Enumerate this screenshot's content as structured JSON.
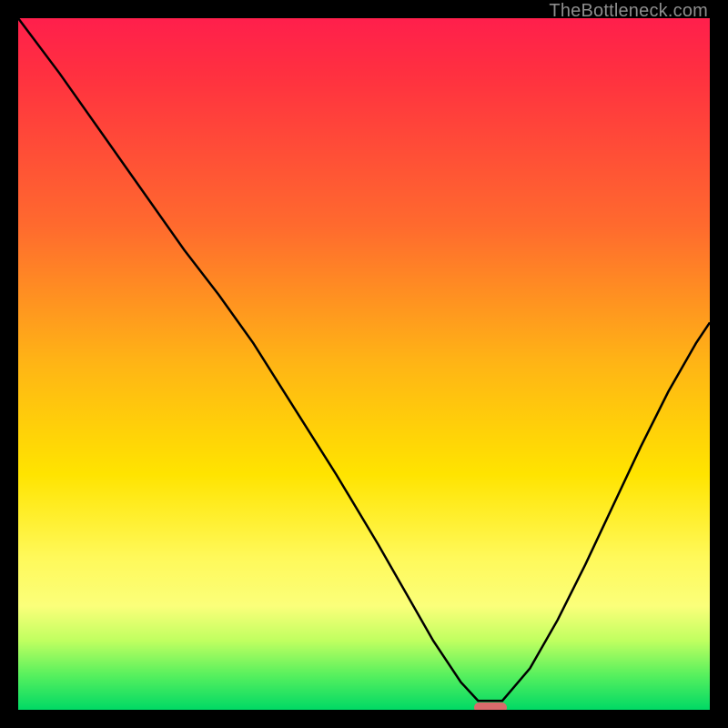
{
  "watermark": "TheBottleneck.com",
  "chart_data": {
    "type": "line",
    "title": "",
    "xlabel": "",
    "ylabel": "",
    "xlim": [
      0,
      1
    ],
    "ylim": [
      0,
      1
    ],
    "grid": false,
    "legend": false,
    "series": [
      {
        "name": "curve",
        "color": "#000000",
        "x": [
          0.0,
          0.06,
          0.12,
          0.18,
          0.24,
          0.29,
          0.34,
          0.4,
          0.46,
          0.52,
          0.56,
          0.6,
          0.64,
          0.665,
          0.7,
          0.74,
          0.78,
          0.82,
          0.86,
          0.9,
          0.94,
          0.98,
          1.0
        ],
        "y": [
          1.0,
          0.92,
          0.835,
          0.75,
          0.665,
          0.6,
          0.53,
          0.435,
          0.34,
          0.24,
          0.17,
          0.1,
          0.04,
          0.013,
          0.013,
          0.06,
          0.13,
          0.21,
          0.295,
          0.38,
          0.46,
          0.53,
          0.56
        ]
      }
    ],
    "marker": {
      "x_center": 0.683,
      "y": 0.0,
      "width_frac": 0.047,
      "color": "#d86b6b"
    },
    "background_gradient": {
      "direction": "vertical",
      "stops": [
        {
          "pos": 0.0,
          "color": "#ff1f4c"
        },
        {
          "pos": 0.3,
          "color": "#ff6a2e"
        },
        {
          "pos": 0.5,
          "color": "#ffb515"
        },
        {
          "pos": 0.66,
          "color": "#ffe400"
        },
        {
          "pos": 0.85,
          "color": "#fbff7a"
        },
        {
          "pos": 1.0,
          "color": "#00d965"
        }
      ]
    }
  }
}
